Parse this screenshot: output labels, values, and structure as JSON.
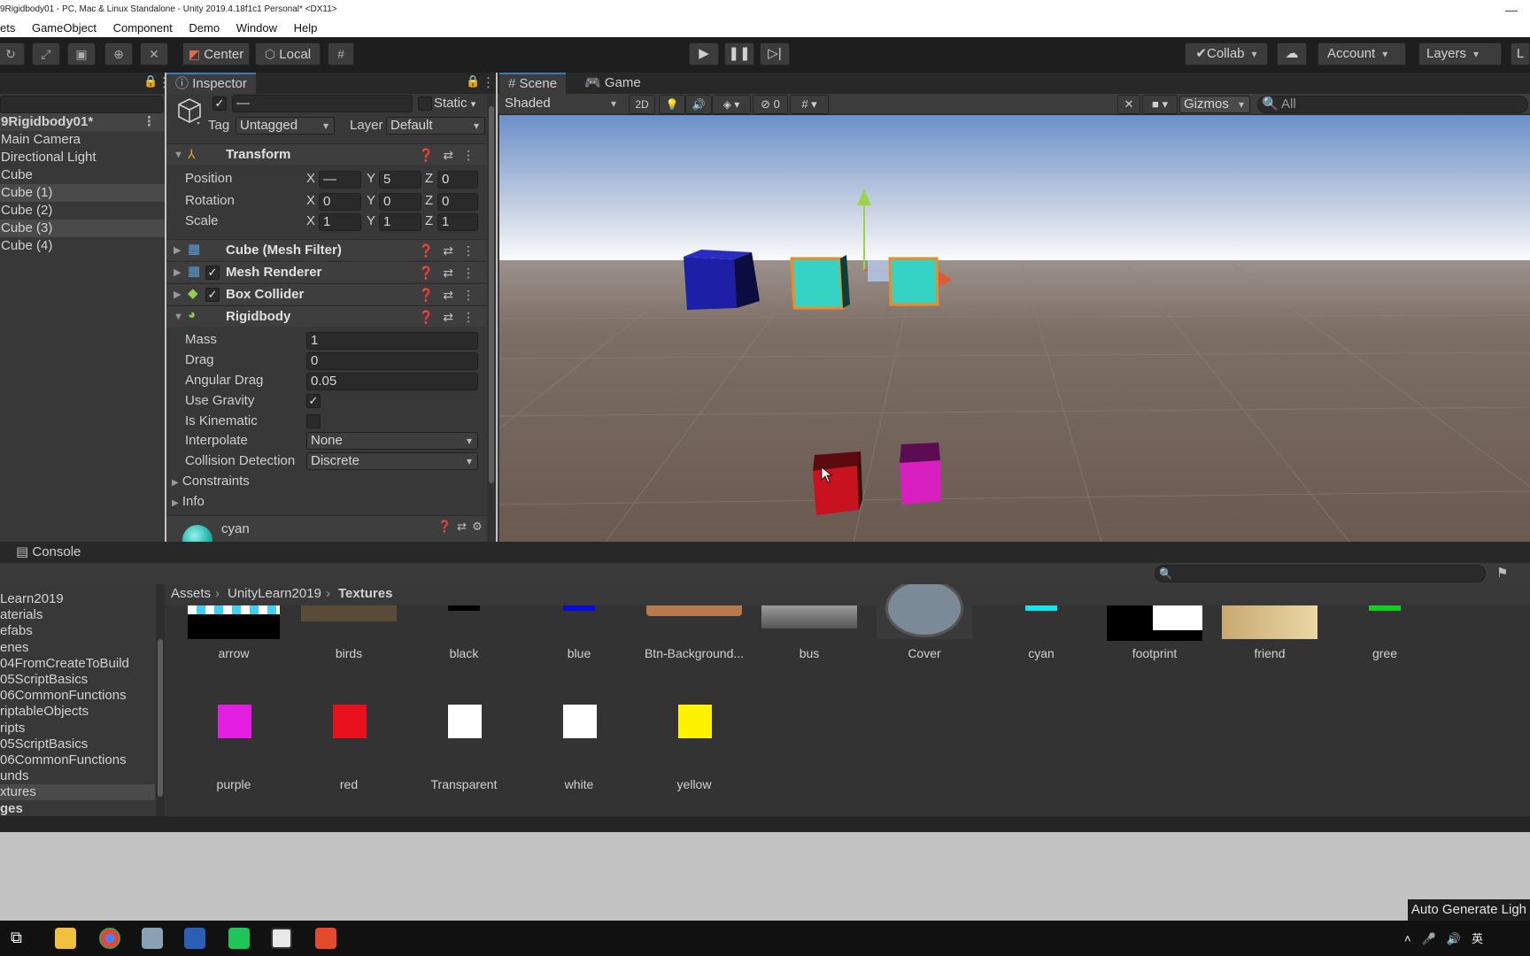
{
  "window": {
    "title": "9Rigidbody01 - PC, Mac & Linux Standalone - Unity 2019.4.18f1c1 Personal* <DX11>",
    "controls": "—"
  },
  "menu": [
    "ets",
    "GameObject",
    "Component",
    "Demo",
    "Window",
    "Help"
  ],
  "toolbar": {
    "center": "Center",
    "local": "Local",
    "collab": "Collab",
    "account": "Account",
    "layers": "Layers",
    "layout": "L"
  },
  "hierarchy": {
    "scene": "9Rigidbody01*",
    "items": [
      {
        "label": "Main Camera",
        "selected": false
      },
      {
        "label": "Directional Light",
        "selected": false
      },
      {
        "label": "Cube",
        "selected": false
      },
      {
        "label": "Cube (1)",
        "selected": true
      },
      {
        "label": "Cube (2)",
        "selected": false
      },
      {
        "label": "Cube (3)",
        "selected": true
      },
      {
        "label": "Cube (4)",
        "selected": false
      }
    ]
  },
  "inspector": {
    "tab": "Inspector",
    "name_value": "—",
    "static_label": "Static",
    "tag_label": "Tag",
    "tag_value": "Untagged",
    "layer_label": "Layer",
    "layer_value": "Default",
    "transform": {
      "title": "Transform",
      "position_label": "Position",
      "rotation_label": "Rotation",
      "scale_label": "Scale",
      "position": {
        "x": "—",
        "y": "5",
        "z": "0"
      },
      "rotation": {
        "x": "0",
        "y": "0",
        "z": "0"
      },
      "scale": {
        "x": "1",
        "y": "1",
        "z": "1"
      }
    },
    "components": {
      "mesh_filter": "Cube (Mesh Filter)",
      "mesh_renderer": "Mesh Renderer",
      "box_collider": "Box Collider",
      "rigidbody": "Rigidbody"
    },
    "rigidbody": {
      "mass_label": "Mass",
      "mass": "1",
      "drag_label": "Drag",
      "drag": "0",
      "angular_drag_label": "Angular Drag",
      "angular_drag": "0.05",
      "use_gravity_label": "Use Gravity",
      "use_gravity": true,
      "is_kinematic_label": "Is Kinematic",
      "is_kinematic": false,
      "interpolate_label": "Interpolate",
      "interpolate": "None",
      "collision_label": "Collision Detection",
      "collision": "Discrete",
      "constraints": "Constraints",
      "info": "Info"
    },
    "material": "cyan"
  },
  "scene": {
    "tab_scene": "Scene",
    "tab_game": "Game",
    "shading": "Shaded",
    "mode_2d": "2D",
    "hidden_count": "0",
    "gizmos": "Gizmos",
    "search_placeholder": "All",
    "colors": {
      "blue": "#1d1fa6",
      "cyan": "#35d3c3",
      "red": "#c8121f",
      "magenta": "#d81fc0",
      "selection": "#f08a24"
    }
  },
  "project": {
    "tab": "Console",
    "folders": [
      {
        "label": "Learn2019",
        "selected": false
      },
      {
        "label": "aterials",
        "selected": false
      },
      {
        "label": "efabs",
        "selected": false
      },
      {
        "label": "enes",
        "selected": false
      },
      {
        "label": "04FromCreateToBuild",
        "selected": false
      },
      {
        "label": "05ScriptBasics",
        "selected": false
      },
      {
        "label": "06CommonFunctions",
        "selected": false
      },
      {
        "label": "riptableObjects",
        "selected": false
      },
      {
        "label": "ripts",
        "selected": false
      },
      {
        "label": "05ScriptBasics",
        "selected": false
      },
      {
        "label": "06CommonFunctions",
        "selected": false
      },
      {
        "label": "unds",
        "selected": false
      },
      {
        "label": "xtures",
        "selected": true
      },
      {
        "label": "ges",
        "selected": false
      }
    ],
    "breadcrumb": [
      "Assets",
      "UnityLearn2019",
      "Textures"
    ],
    "assets_row1": [
      "arrow",
      "birds",
      "black",
      "blue",
      "Btn-Background...",
      "bus",
      "Cover",
      "cyan",
      "footprint",
      "friend",
      "gree"
    ],
    "assets_row2": [
      {
        "name": "purple",
        "color": "#e21ee0"
      },
      {
        "name": "red",
        "color": "#e8101c"
      },
      {
        "name": "Transparent",
        "color": "#ffffff"
      },
      {
        "name": "white",
        "color": "#ffffff"
      },
      {
        "name": "yellow",
        "color": "#fff200"
      }
    ]
  },
  "status": "Auto Generate Ligh"
}
